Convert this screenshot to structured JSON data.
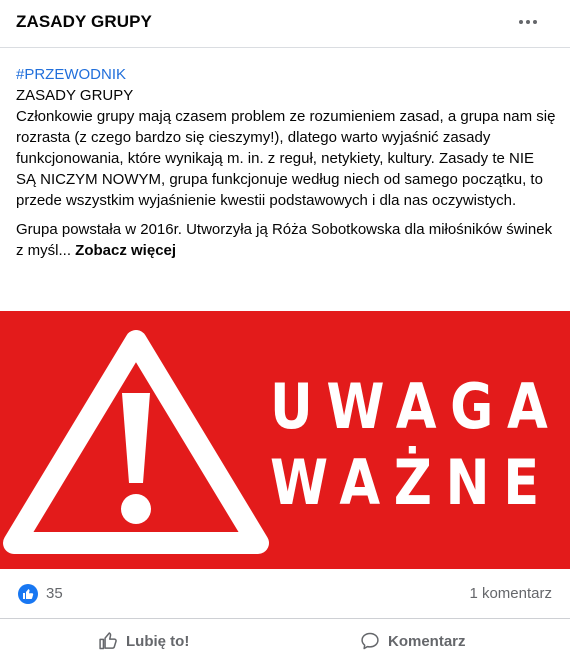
{
  "header": {
    "title": "ZASADY GRUPY",
    "more_icon": "more-horizontal-icon"
  },
  "post": {
    "hashtag": "#PRZEWODNIK",
    "heading": "ZASADY GRUPY",
    "paragraph1": "Członkowie grupy mają czasem problem ze rozumieniem zasad, a grupa nam się rozrasta (z czego bardzo się cieszymy!), dlatego warto wyjaśnić zasady funkcjonowania, które wynikają m. in. z reguł, netykiety, kultury. Zasady te NIE SĄ NICZYM NOWYM, grupa funkcjonuje według niech od samego początku, to przede wszystkim wyjaśnienie kwestii podstawowych i dla nas oczywistych.",
    "paragraph2": "Grupa powstała w 2016r. Utworzyła ją Róża Sobotkowska dla miłośników świnek z myśl...",
    "see_more": "Zobacz więcej"
  },
  "banner": {
    "background_color": "#e31b1b",
    "icon": "warning-triangle-icon",
    "line1": "UWAGA",
    "line2": "WAŻNE"
  },
  "stats": {
    "reaction_icon": "like-reaction-icon",
    "likes": "35",
    "comments": "1 komentarz"
  },
  "actions": {
    "like_label": "Lubię to!",
    "like_icon": "thumbs-up-icon",
    "comment_label": "Komentarz",
    "comment_icon": "comment-bubble-icon"
  },
  "colors": {
    "link": "#216fdb",
    "accent": "#1877f2",
    "muted": "#65676b"
  }
}
